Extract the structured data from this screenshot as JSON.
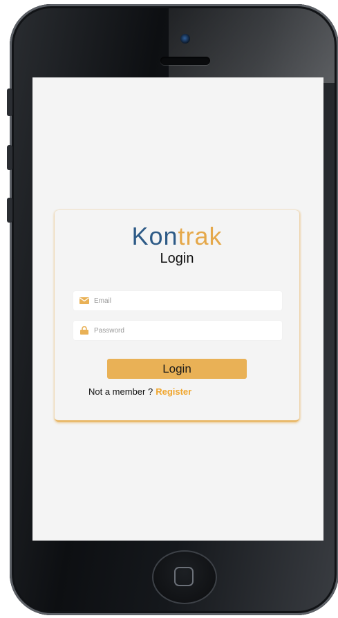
{
  "app": {
    "logo_part1": "Kon",
    "logo_part2": "trak",
    "brand_blue": "#2d5a86",
    "brand_gold": "#e5a84a"
  },
  "login_form": {
    "title": "Login",
    "email_placeholder": "Email",
    "email_icon": "envelope-icon",
    "password_placeholder": "Password",
    "password_icon": "lock-icon",
    "submit_label": "Login",
    "not_member_text": "Not a member ?",
    "register_label": "Register"
  },
  "device": {
    "frame": "phone-mockup",
    "home_button_icon": "home-square-icon"
  }
}
